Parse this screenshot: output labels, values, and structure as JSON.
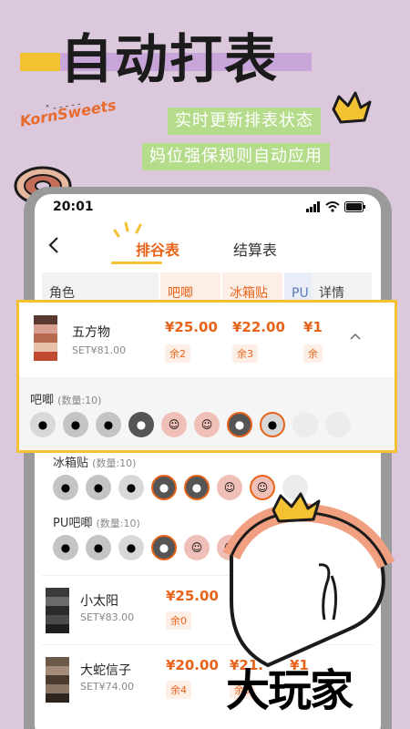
{
  "promo": {
    "title": "自动打表",
    "brand": "KornSweets",
    "tagline1": "实时更新排表状态",
    "tagline2": "妈位强保规则自动应用"
  },
  "status_bar": {
    "time": "20:01"
  },
  "nav": {
    "back_icon": "chevron-left-icon",
    "tab_active": "排谷表",
    "tab_inactive": "结算表"
  },
  "table_header": {
    "role": "角色",
    "col1": "吧唧",
    "col2": "冰箱贴",
    "col3": "PU",
    "detail": "详情"
  },
  "featured": {
    "name": "五方物",
    "set": "SET¥81.00",
    "price1": "¥25.00",
    "stock1": "余2",
    "price2": "¥22.00",
    "stock2": "余3",
    "price3": "¥1",
    "stock3": "余",
    "expand_icon": "chevron-up-icon",
    "sub1_label": "吧唧",
    "sub1_count": "(数量:10)"
  },
  "sub2": {
    "label": "冰箱贴",
    "count": "(数量:10)"
  },
  "sub3": {
    "label": "PU吧唧",
    "count": "(数量:10)"
  },
  "rows": [
    {
      "name": "小太阳",
      "set": "SET¥83.00",
      "price1": "¥25.00",
      "stock1": "余0"
    },
    {
      "name": "大蛇信子",
      "set": "SET¥74.00",
      "price1": "¥20.00",
      "stock1": "余4",
      "price2": "¥21.",
      "stock2": "余5",
      "price3": "¥1"
    }
  ],
  "stamp": "大玩家",
  "colors": {
    "accent": "#e8631a",
    "highlight": "#f2c232",
    "background": "#dcc8dc",
    "tag_green": "#b5dc8a"
  }
}
